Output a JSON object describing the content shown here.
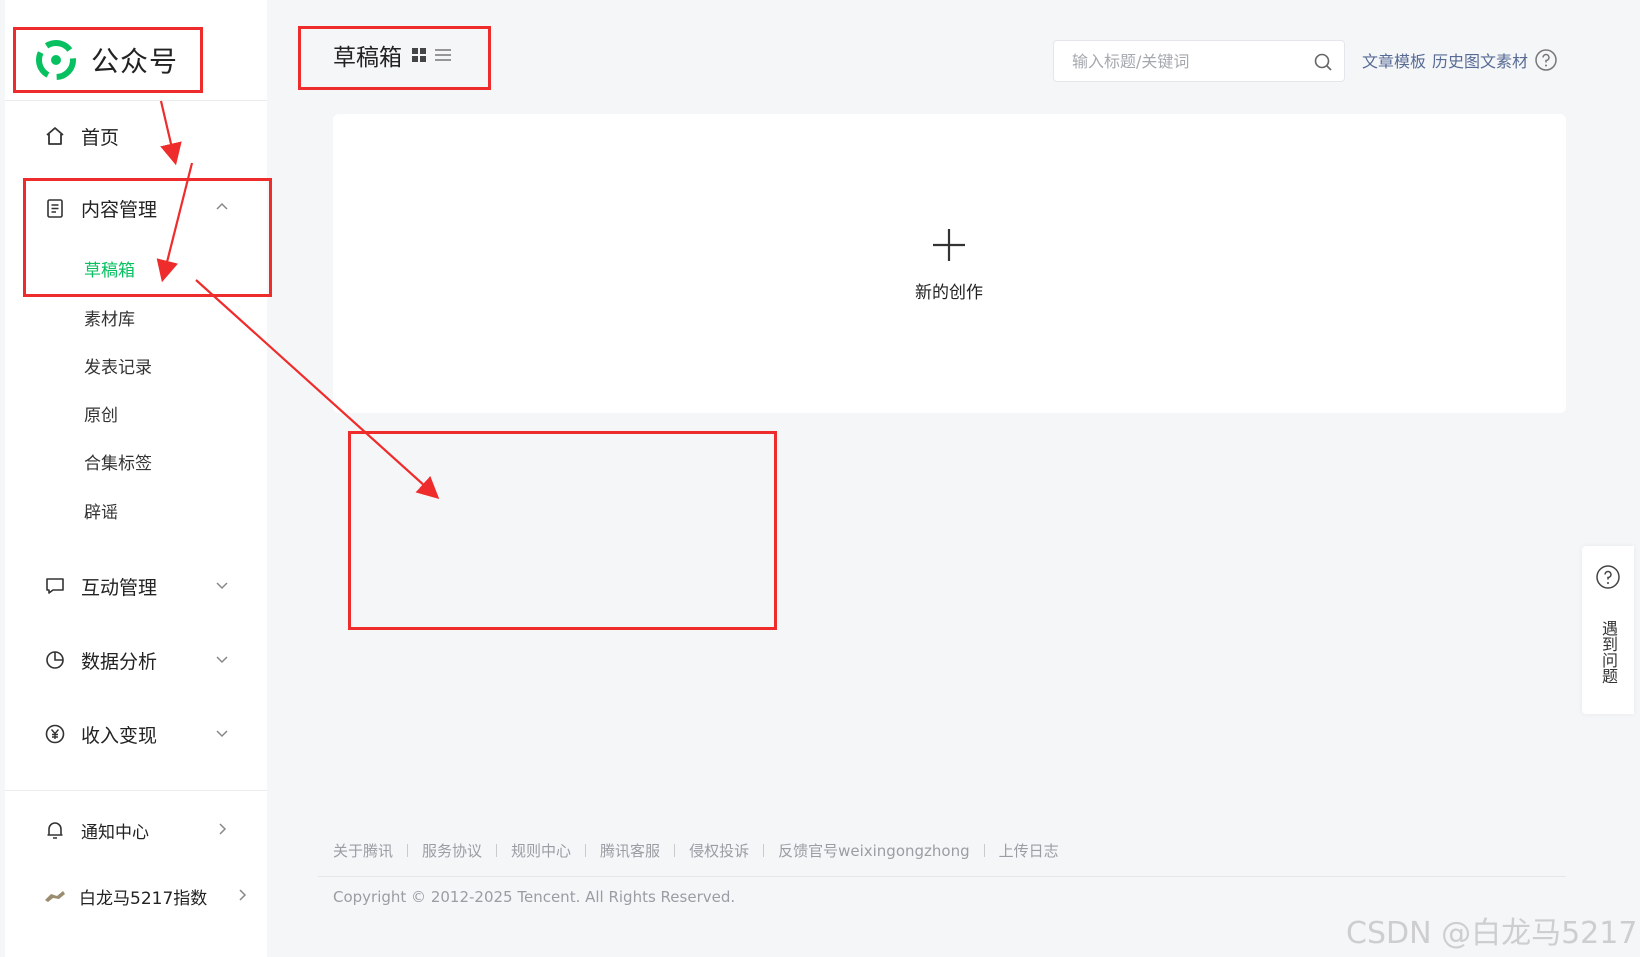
{
  "brand": {
    "name": "公众号",
    "logo_color": "#07c160"
  },
  "nav": {
    "home": "首页",
    "content": "内容管理",
    "content_sub": [
      "草稿箱",
      "素材库",
      "发表记录",
      "原创",
      "合集标签",
      "辟谣"
    ],
    "interact": "互动管理",
    "data": "数据分析",
    "revenue": "收入变现",
    "notify": "通知中心",
    "user": "白龙马5217指数"
  },
  "header": {
    "title": "草稿箱",
    "search_placeholder": "输入标题/关键词",
    "links": [
      "文章模板",
      "历史图文素材"
    ]
  },
  "main": {
    "new_create": "新的创作"
  },
  "footer": {
    "links": [
      "关于腾讯",
      "服务协议",
      "规则中心",
      "腾讯客服",
      "侵权投诉",
      "反馈官号weixingongzhong",
      "上传日志"
    ],
    "copyright": "Copyright © 2012-2025 Tencent. All Rights Reserved."
  },
  "help_float": {
    "label": "遇到问题"
  },
  "watermark": "CSDN @白龙马5217",
  "colors": {
    "accent": "#07c160",
    "link": "#576b95",
    "annotation": "#ef2c2c"
  }
}
